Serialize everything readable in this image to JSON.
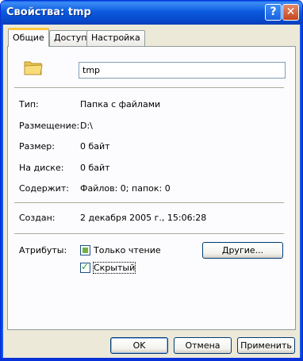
{
  "window": {
    "title": "Свойства: tmp"
  },
  "titlebar": {
    "help_label": "?",
    "close_label": "✕"
  },
  "tabs": [
    {
      "label": "Общие",
      "active": true
    },
    {
      "label": "Доступ",
      "active": false
    },
    {
      "label": "Настройка",
      "active": false
    }
  ],
  "general": {
    "folder_icon": "folder-icon",
    "name_value": "tmp",
    "rows": [
      {
        "label": "Тип:",
        "value": "Папка с файлами"
      },
      {
        "label": "Размещение:",
        "value": "D:\\"
      },
      {
        "label": "Размер:",
        "value": "0 байт"
      },
      {
        "label": "На диске:",
        "value": "0 байт"
      },
      {
        "label": "Содержит:",
        "value": "Файлов: 0; папок: 0"
      }
    ],
    "created_label": "Создан:",
    "created_value": "2 декабря 2005 г., 15:06:28",
    "attributes_label": "Атрибуты:",
    "readonly_label": "Только чтение",
    "readonly_state": "indeterminate",
    "hidden_label": "Скрытый",
    "hidden_checked": true,
    "advanced_button": "Другие..."
  },
  "footer": {
    "ok": "OK",
    "cancel": "Отмена",
    "apply": "Применить"
  },
  "colors": {
    "titlebar": "#0a5fe8",
    "face": "#ece9d8",
    "tab_highlight": "#ffc83c"
  }
}
